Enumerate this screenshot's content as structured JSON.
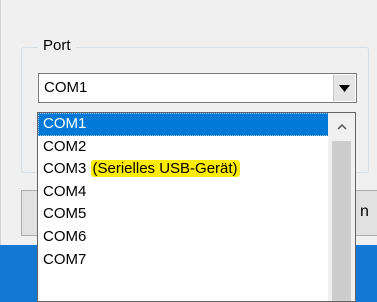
{
  "port_group": {
    "label": "Port",
    "selected_value": "COM1"
  },
  "dropdown": {
    "items": [
      {
        "label": "COM1",
        "note": ""
      },
      {
        "label": "COM2",
        "note": ""
      },
      {
        "label": "COM3",
        "note": "(Serielles USB-Gerät)"
      },
      {
        "label": "COM4",
        "note": ""
      },
      {
        "label": "COM5",
        "note": ""
      },
      {
        "label": "COM6",
        "note": ""
      },
      {
        "label": "COM7",
        "note": ""
      }
    ],
    "selected_index": 0
  },
  "background_button_right_fragment": "n",
  "colors": {
    "selection": "#0078d7",
    "highlight_marker": "#ffec00",
    "taskbar": "#1378d4"
  },
  "icons": {
    "combobox_arrow": "chevron-down-icon",
    "scroll_up": "chevron-up-icon"
  }
}
